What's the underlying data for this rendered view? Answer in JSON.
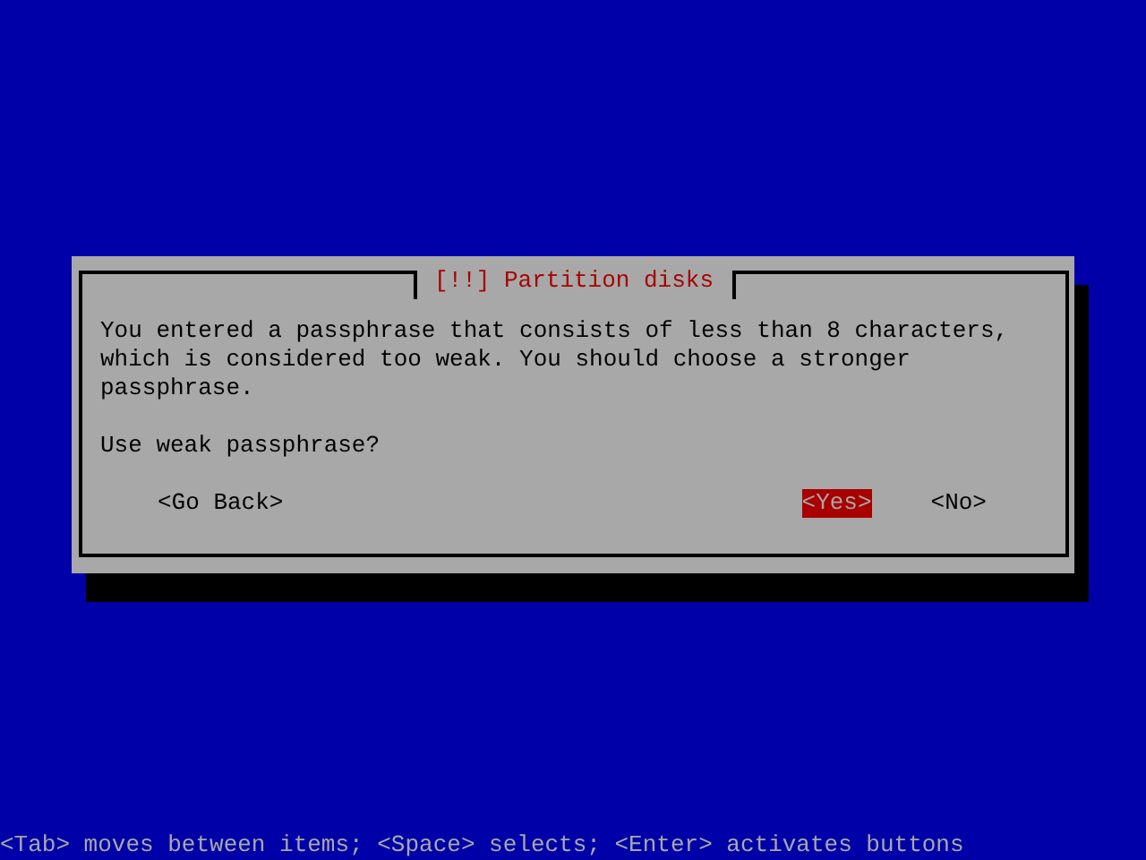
{
  "dialog": {
    "title": "[!!] Partition disks",
    "message": "You entered a passphrase that consists of less than 8 characters, which is considered too weak. You should choose a stronger passphrase.",
    "question": "Use weak passphrase?",
    "buttons": [
      {
        "label": "<Go Back>",
        "selected": false,
        "kind": "back"
      },
      {
        "label": "<Yes>",
        "selected": true,
        "kind": "choice"
      },
      {
        "label": "<No>",
        "selected": false,
        "kind": "choice"
      }
    ]
  },
  "status_bar": "<Tab> moves between items; <Space> selects; <Enter> activates buttons"
}
